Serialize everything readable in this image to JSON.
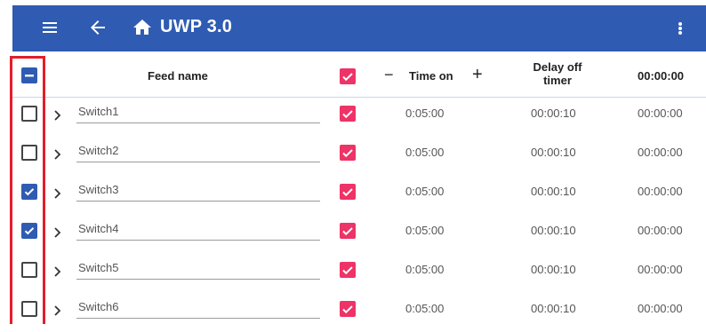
{
  "appbar": {
    "title": "UWP 3.0",
    "icons": [
      "menu-icon",
      "arrow-back-icon",
      "home-icon",
      "more-vert-icon"
    ],
    "color": "#2f5bb2"
  },
  "table": {
    "header": {
      "select_all_state": "indeterminate",
      "feed_name": "Feed name",
      "enabled_checked": true,
      "time_on_label": "Time on",
      "time_on_minus": "−",
      "time_on_plus": "+",
      "delay_off_line1": "Delay off",
      "delay_off_line2": "timer",
      "remaining": "00:00:00"
    },
    "rows": [
      {
        "selected": false,
        "name": "Switch1",
        "enabled": true,
        "time_on": "0:05:00",
        "delay_off": "00:00:10",
        "remaining": "00:00:00"
      },
      {
        "selected": false,
        "name": "Switch2",
        "enabled": true,
        "time_on": "0:05:00",
        "delay_off": "00:00:10",
        "remaining": "00:00:00"
      },
      {
        "selected": true,
        "name": "Switch3",
        "enabled": true,
        "time_on": "0:05:00",
        "delay_off": "00:00:10",
        "remaining": "00:00:00"
      },
      {
        "selected": true,
        "name": "Switch4",
        "enabled": true,
        "time_on": "0:05:00",
        "delay_off": "00:00:10",
        "remaining": "00:00:00"
      },
      {
        "selected": false,
        "name": "Switch5",
        "enabled": true,
        "time_on": "0:05:00",
        "delay_off": "00:00:10",
        "remaining": "00:00:00"
      },
      {
        "selected": false,
        "name": "Switch6",
        "enabled": true,
        "time_on": "0:05:00",
        "delay_off": "00:00:10",
        "remaining": "00:00:00"
      }
    ]
  },
  "colors": {
    "accent_blue": "#2f5bb2",
    "enabled_pink": "#ee3366",
    "highlight_red": "#e21e2a"
  }
}
